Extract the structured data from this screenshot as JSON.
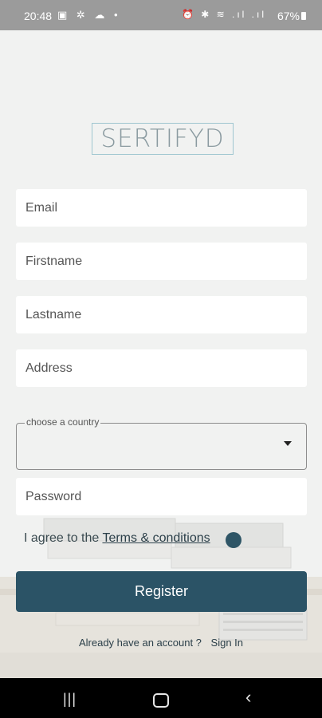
{
  "status": {
    "time": "20:48",
    "left_icons": "▣ ✲ ☁ •",
    "right_icons": "⏰ ✱ ≋ .ıl .ıl",
    "battery": "67%"
  },
  "logo": {
    "text": "SERTIFYD"
  },
  "form": {
    "email_placeholder": "Email",
    "firstname_placeholder": "Firstname",
    "lastname_placeholder": "Lastname",
    "address_placeholder": "Address",
    "country_label": "choose a country",
    "country_value": "",
    "password_placeholder": "Password",
    "agree_text": "I agree to the ",
    "terms_link": "Terms & conditions",
    "register_label": "Register",
    "already_text": "Already have an account ?",
    "signin_link": "Sign In"
  },
  "nav": {
    "recent": "|||",
    "back": "‹"
  },
  "colors": {
    "primary": "#2b5366",
    "background": "#f1f2f1",
    "logo_border": "#9fc6d0"
  }
}
